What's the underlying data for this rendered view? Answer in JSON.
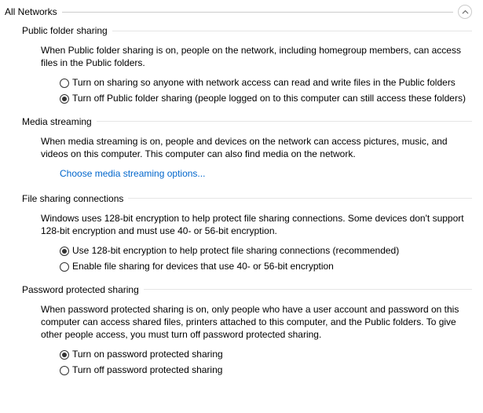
{
  "header": {
    "title": "All Networks"
  },
  "sections": {
    "publicFolder": {
      "title": "Public folder sharing",
      "description": "When Public folder sharing is on, people on the network, including homegroup members, can access files in the Public folders.",
      "options": {
        "on": "Turn on sharing so anyone with network access can read and write files in the Public folders",
        "off": "Turn off Public folder sharing (people logged on to this computer can still access these folders)"
      }
    },
    "mediaStreaming": {
      "title": "Media streaming",
      "description": "When media streaming is on, people and devices on the network can access pictures, music, and videos on this computer. This computer can also find media on the network.",
      "link": "Choose media streaming options..."
    },
    "fileSharing": {
      "title": "File sharing connections",
      "description": "Windows uses 128-bit encryption to help protect file sharing connections. Some devices don't support 128-bit encryption and must use 40- or 56-bit encryption.",
      "options": {
        "bit128": "Use 128-bit encryption to help protect file sharing connections (recommended)",
        "bit40": "Enable file sharing for devices that use 40- or 56-bit encryption"
      }
    },
    "passwordProtected": {
      "title": "Password protected sharing",
      "description": "When password protected sharing is on, only people who have a user account and password on this computer can access shared files, printers attached to this computer, and the Public folders. To give other people access, you must turn off password protected sharing.",
      "options": {
        "on": "Turn on password protected sharing",
        "off": "Turn off password protected sharing"
      }
    }
  }
}
